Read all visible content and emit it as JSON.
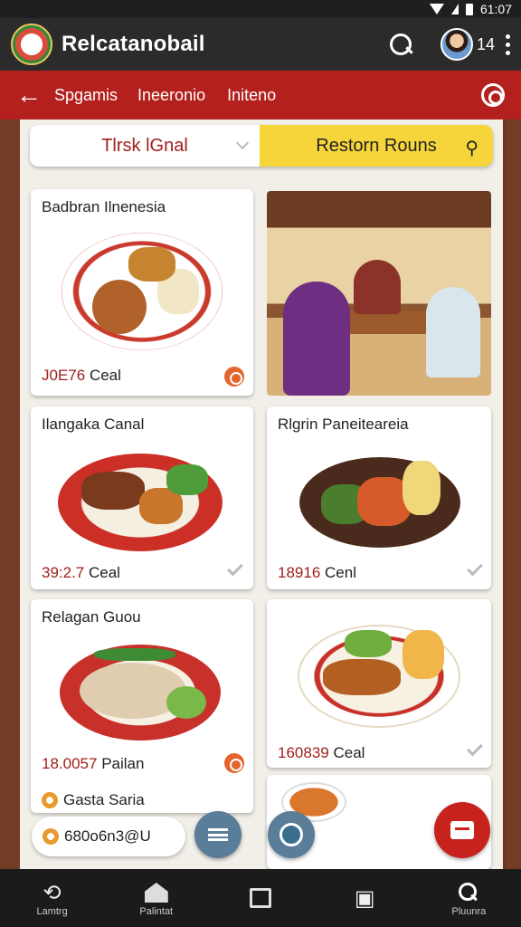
{
  "status_bar": {
    "time": "61:07"
  },
  "app_bar": {
    "title": "Relcatanobail",
    "badge_count": "14"
  },
  "nav": {
    "items": [
      "Spgamis",
      "Ineeronio",
      "Initeno"
    ]
  },
  "filters": {
    "left_label": "Tlrsk lGnal",
    "right_label": "Restorn Rouns",
    "right_accent": "#f5d53a"
  },
  "cards": [
    {
      "title": "Badbran Ilnenesia",
      "number": "J0E76",
      "unit": "Cеal",
      "action_icon": "favorite-icon"
    },
    {
      "title": "Ilangaka Canal",
      "number": "39:2.7",
      "unit": "Cеal",
      "action_icon": "check-icon"
    },
    {
      "title": "Rlgrin Paneiteareia",
      "number": "18916",
      "unit": "Cenl",
      "action_icon": "check-icon"
    },
    {
      "title": "Relagan Guou",
      "number": "18.0057",
      "unit": "Pailan",
      "action_icon": "favorite-icon"
    },
    {
      "title": "",
      "number": "160839",
      "unit": "Cеal",
      "action_icon": "check-icon"
    }
  ],
  "extra_item": {
    "label": "Gasta Saria"
  },
  "bottom_pill": {
    "label": "680o6n3@U"
  },
  "tabs": [
    {
      "label": "Lamtrg",
      "icon": "undo-icon"
    },
    {
      "label": "Palintat",
      "icon": "home-icon"
    },
    {
      "label": "",
      "icon": "square-icon"
    },
    {
      "label": "",
      "icon": "photo-icon"
    },
    {
      "label": "Pluunra",
      "icon": "search-icon"
    }
  ],
  "colors": {
    "header_dark": "#2b2b2b",
    "nav_red": "#b3201d",
    "accent_red": "#a0201c"
  }
}
